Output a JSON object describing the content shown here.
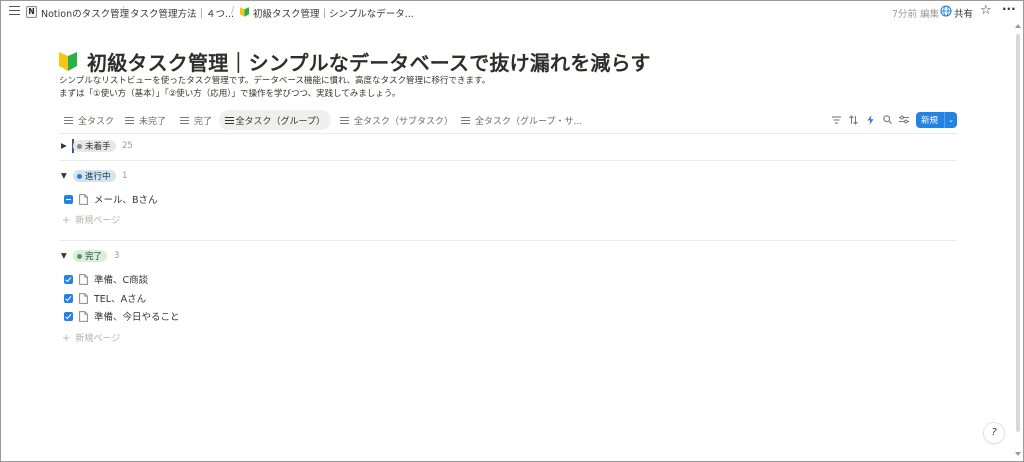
{
  "topbar": {
    "workspace_label": "Notionのタスク管理",
    "crumb2": "タスク管理方法｜４つ...",
    "crumb3": "初級タスク管理｜シンプルなデータ...",
    "edited": "7分前 編集",
    "share": "共有"
  },
  "page": {
    "title": "初級タスク管理｜シンプルなデータベースで抜け漏れを減らす",
    "desc1": "シンプルなリストビューを使ったタスク管理です。データベース機能に慣れ、高度なタスク管理に移行できます。",
    "desc2": "まずは「①使い方（基本）」「②使い方（応用）」で操作を学びつつ、実践してみましょう。"
  },
  "views": {
    "tabs": [
      {
        "label": "全タスク",
        "active": false
      },
      {
        "label": "未完了",
        "active": false
      },
      {
        "label": "完了",
        "active": false
      },
      {
        "label": "全タスク（グループ）",
        "active": true
      },
      {
        "label": "全タスク（サブタスク）",
        "active": false
      },
      {
        "label": "全タスク（グループ・サ...",
        "active": false
      }
    ],
    "new_button": "新規"
  },
  "groups": [
    {
      "label": "未着手",
      "count": "25",
      "expanded": false,
      "color": "#8c8b87"
    },
    {
      "label": "進行中",
      "count": "1",
      "expanded": true,
      "color": "#2e7cd6",
      "items": [
        {
          "title": "メール、Bさん",
          "state": "partial"
        }
      ]
    },
    {
      "label": "完了",
      "count": "3",
      "expanded": true,
      "color": "#4a9c5e",
      "items": [
        {
          "title": "準備、C商談",
          "state": "checked"
        },
        {
          "title": "TEL、Aさん",
          "state": "checked"
        },
        {
          "title": "準備、今日やること",
          "state": "checked"
        }
      ]
    }
  ],
  "add_page_label": "新規ページ",
  "help_label": "?",
  "icons": [
    "menu-icon",
    "notion-logo-icon",
    "beginner-leaf-icon",
    "globe-icon",
    "star-icon",
    "more-icon",
    "list-view-icon",
    "filter-icon",
    "sort-icon",
    "automation-icon",
    "search-icon",
    "settings-icon",
    "page-icon",
    "checkbox-icon"
  ]
}
